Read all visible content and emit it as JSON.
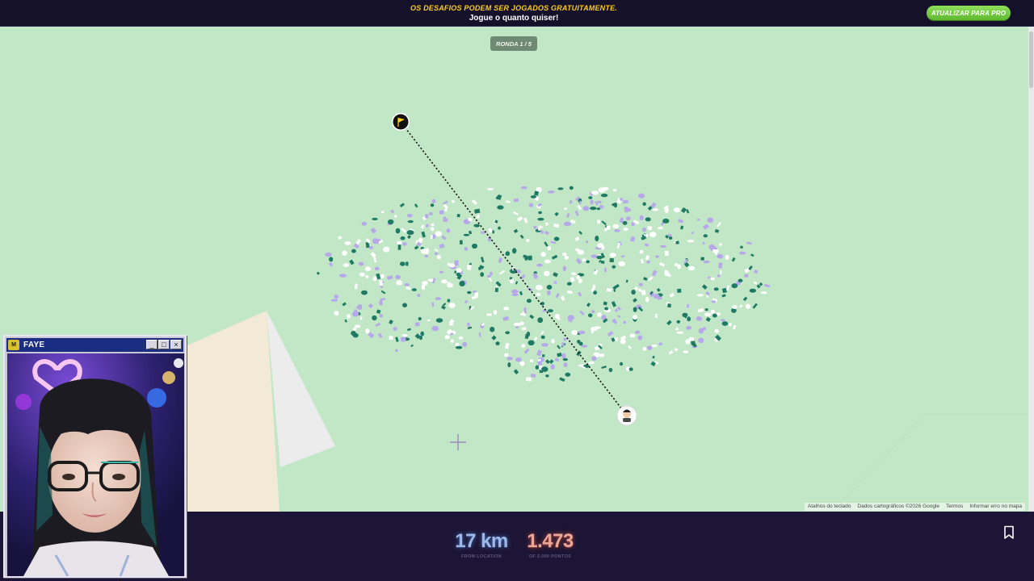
{
  "banner": {
    "line1": "OS DESAFIOS PODEM SER JOGADOS GRATUITAMENTE.",
    "line2": "Jogue o quanto quiser!",
    "upgrade_label": "ATUALIZAR PARA PRO"
  },
  "map": {
    "round_label": "RONDA 1 / 5",
    "attribution": {
      "shortcuts": "Atalhos do teclado",
      "map_data": "Dados cartográficos ©2026 Google",
      "terms": "Termos",
      "report": "Informar erro no mapa"
    }
  },
  "result": {
    "distance": "17 km",
    "distance_label": "FROM LOCATION",
    "points": "1.473",
    "points_label": "OF 5.000 PONTOS"
  },
  "webcam": {
    "title": "FAYE",
    "logo_text": "M"
  },
  "colors": {
    "map_green": "#c2e7c6",
    "banner_yellow": "#fecd19",
    "upgrade_green": "#7acb45",
    "confetti": [
      "#1f7a63",
      "#b7a8ea",
      "#ffffff"
    ]
  }
}
